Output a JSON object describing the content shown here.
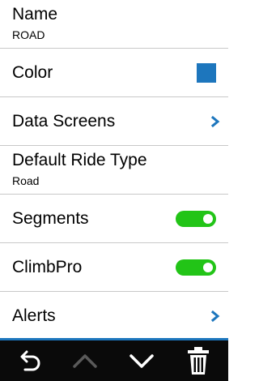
{
  "settings": {
    "items": [
      {
        "label": "Name",
        "value": "ROAD"
      },
      {
        "label": "Color",
        "color": "#1d76bd"
      },
      {
        "label": "Data Screens"
      },
      {
        "label": "Default Ride Type",
        "value": "Road"
      },
      {
        "label": "Segments",
        "toggle": true
      },
      {
        "label": "ClimbPro",
        "toggle": true
      },
      {
        "label": "Alerts"
      }
    ]
  },
  "toolbar": {
    "buttons": [
      "back-icon",
      "chevron-up-icon",
      "chevron-down-icon",
      "trash-icon"
    ]
  },
  "colors": {
    "accent": "#1d76bd",
    "toggle_on": "#22c417",
    "toolbar_bg": "#0a0a0a"
  }
}
